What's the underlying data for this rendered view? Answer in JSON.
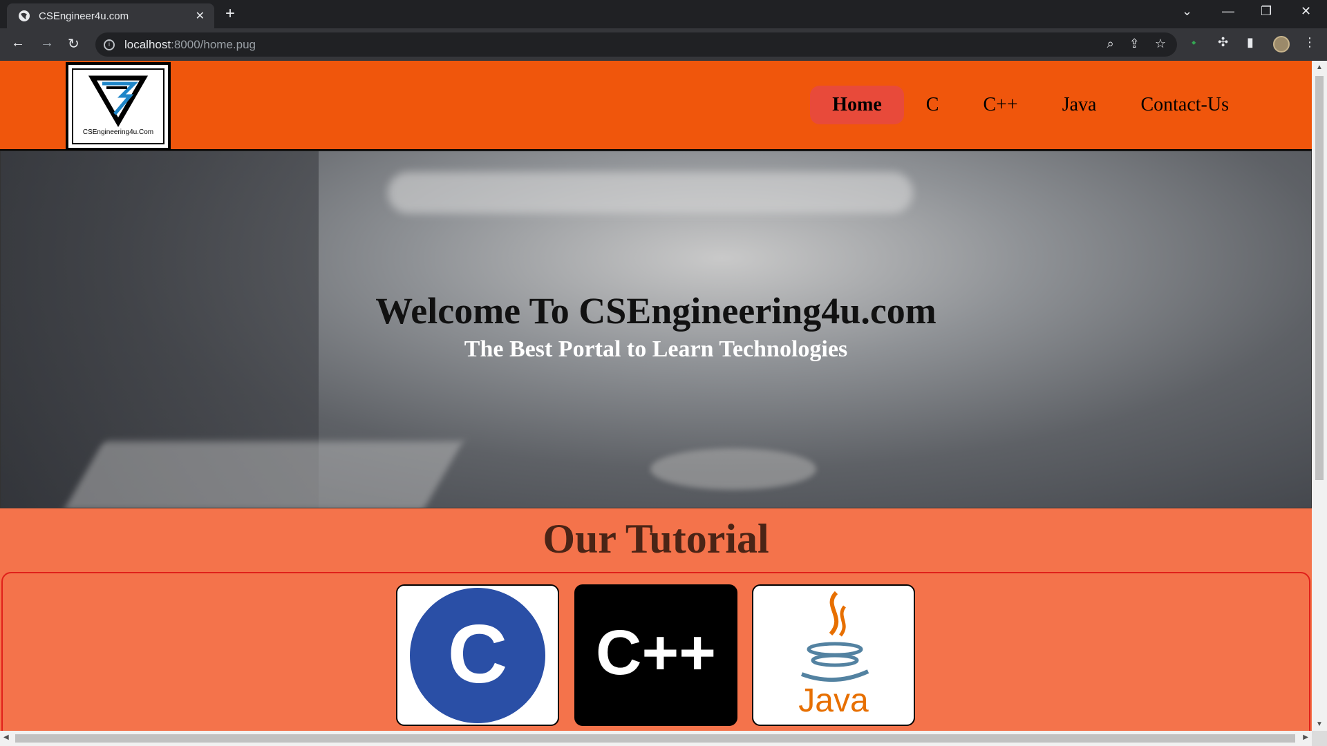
{
  "browser": {
    "tab_title": "CSEngineer4u.com",
    "tab_close": "✕",
    "new_tab": "+",
    "url_host": "localhost",
    "url_path": ":8000/home.pug",
    "controls": {
      "chevron": "⌄",
      "minimize": "—",
      "restore": "❐",
      "close": "✕"
    },
    "nav": {
      "back": "←",
      "forward": "→",
      "reload": "↻"
    },
    "omni_icons": {
      "zoom": "⌕",
      "share": "⇪",
      "star": "☆"
    },
    "right_icons": {
      "extension_dot": "⬩",
      "puzzle": "✣",
      "sidebar": "▮",
      "menu": "⋮"
    }
  },
  "site": {
    "logo_text": "CSEngineering4u.Com",
    "nav": [
      "Home",
      "C",
      "C++",
      "Java",
      "Contact-Us"
    ],
    "hero": {
      "title": "Welcome To CSEngineering4u.com",
      "subtitle": "The Best Portal to Learn Technologies"
    },
    "tutorial_title": "Our Tutorial",
    "cards": [
      {
        "label": "C",
        "color": "#2a4fa6"
      },
      {
        "label": "C++",
        "color": "#000000"
      },
      {
        "label": "Java",
        "color": "#e76f00"
      }
    ]
  },
  "colors": {
    "header": "#f0560c",
    "active_nav": "#e84a3a",
    "page_bg": "#f4734b"
  }
}
